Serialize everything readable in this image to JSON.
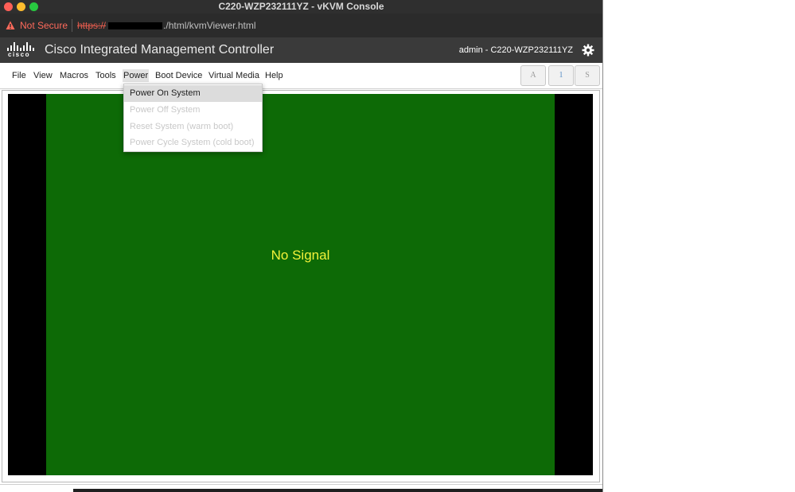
{
  "window": {
    "title": "C220-WZP232111YZ - vKVM Console",
    "colors": {
      "close": "#fe5f57",
      "minimize": "#febc2e",
      "zoom": "#28c840"
    }
  },
  "address_bar": {
    "security_label": "Not Secure",
    "url_scheme": "https://",
    "url_path": "./html/kvmViewer.html",
    "icon": "warning-triangle-icon"
  },
  "header": {
    "logo_text": "cisco",
    "title": "Cisco Integrated Management Controller",
    "user": "admin - C220-WZP232111YZ",
    "settings_icon": "gear-icon"
  },
  "menu": {
    "items": [
      "File",
      "View",
      "Macros",
      "Tools",
      "Power",
      "Boot Device",
      "Virtual Media",
      "Help"
    ],
    "active": "Power"
  },
  "lock_keys": [
    "A",
    "1",
    "S"
  ],
  "power_menu": {
    "items": [
      {
        "label": "Power On System",
        "enabled": true
      },
      {
        "label": "Power Off System",
        "enabled": false
      },
      {
        "label": "Reset System (warm boot)",
        "enabled": false
      },
      {
        "label": "Power Cycle System (cold boot)",
        "enabled": false
      }
    ]
  },
  "viewer": {
    "status": "No Signal",
    "colors": {
      "background": "#0d6a06",
      "text": "#f2f23a"
    }
  }
}
